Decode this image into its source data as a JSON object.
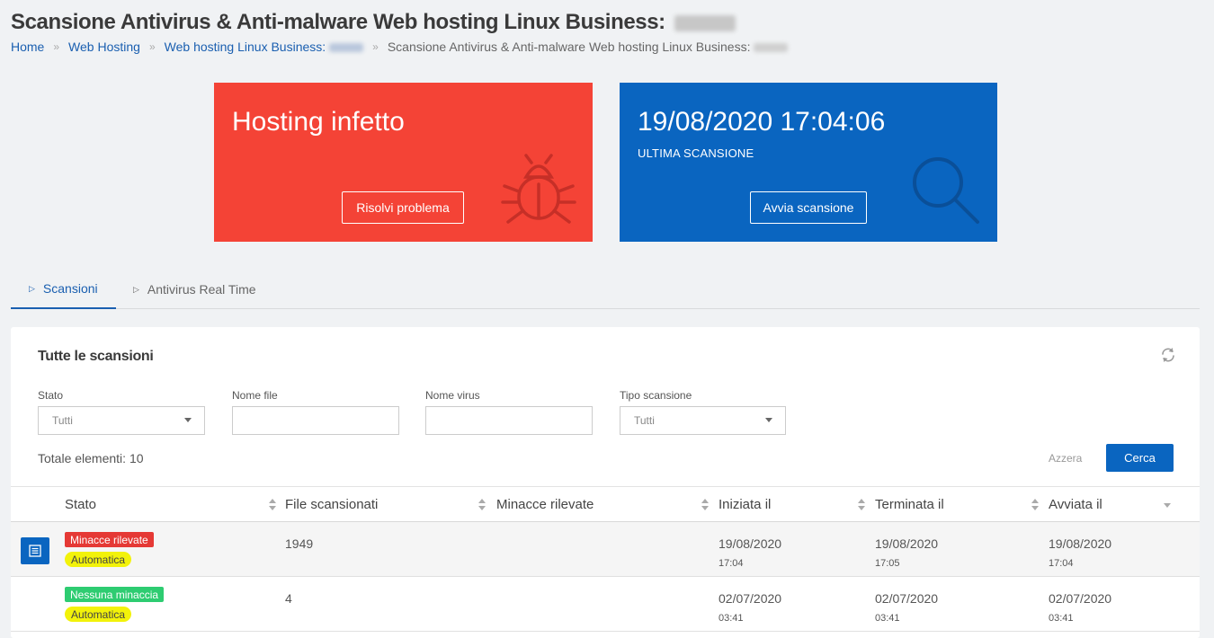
{
  "page": {
    "title": "Scansione Antivirus & Anti-malware Web hosting Linux Business:"
  },
  "breadcrumb": {
    "home": "Home",
    "web_hosting": "Web Hosting",
    "linux_business": "Web hosting Linux Business:",
    "current": "Scansione Antivirus & Anti-malware Web hosting Linux Business:",
    "separator": "»"
  },
  "status_card": {
    "title": "Hosting infetto",
    "button": "Risolvi problema",
    "color": "#f44336",
    "icon": "bug-icon"
  },
  "scan_card": {
    "datetime": "19/08/2020 17:04:06",
    "subtitle": "ULTIMA SCANSIONE",
    "button": "Avvia scansione",
    "color": "#0a65c0",
    "icon": "magnifier-icon"
  },
  "tabs": [
    {
      "label": "Scansioni",
      "active": true
    },
    {
      "label": "Antivirus Real Time",
      "active": false
    }
  ],
  "panel": {
    "title": "Tutte le scansioni",
    "filters": {
      "stato": {
        "label": "Stato",
        "value": "Tutti"
      },
      "nome_file": {
        "label": "Nome file",
        "value": ""
      },
      "nome_virus": {
        "label": "Nome virus",
        "value": ""
      },
      "tipo_scansione": {
        "label": "Tipo scansione",
        "value": "Tutti"
      }
    },
    "total": "Totale elementi: 10",
    "reset": "Azzera",
    "search": "Cerca"
  },
  "table": {
    "columns": [
      "Stato",
      "File scansionati",
      "Minacce rilevate",
      "Iniziata il",
      "Terminata il",
      "Avviata il"
    ],
    "rows": [
      {
        "status": "Minacce rilevate",
        "status_color": "#e53935",
        "type": "Automatica",
        "files": "1949",
        "threats": "",
        "started_date": "19/08/2020",
        "started_time": "17:04",
        "ended_date": "19/08/2020",
        "ended_time": "17:05",
        "launched_date": "19/08/2020",
        "launched_time": "17:04"
      },
      {
        "status": "Nessuna minaccia",
        "status_color": "#2ecc71",
        "type": "Automatica",
        "files": "4",
        "threats": "",
        "started_date": "02/07/2020",
        "started_time": "03:41",
        "ended_date": "02/07/2020",
        "ended_time": "03:41",
        "launched_date": "02/07/2020",
        "launched_time": "03:41"
      }
    ]
  }
}
